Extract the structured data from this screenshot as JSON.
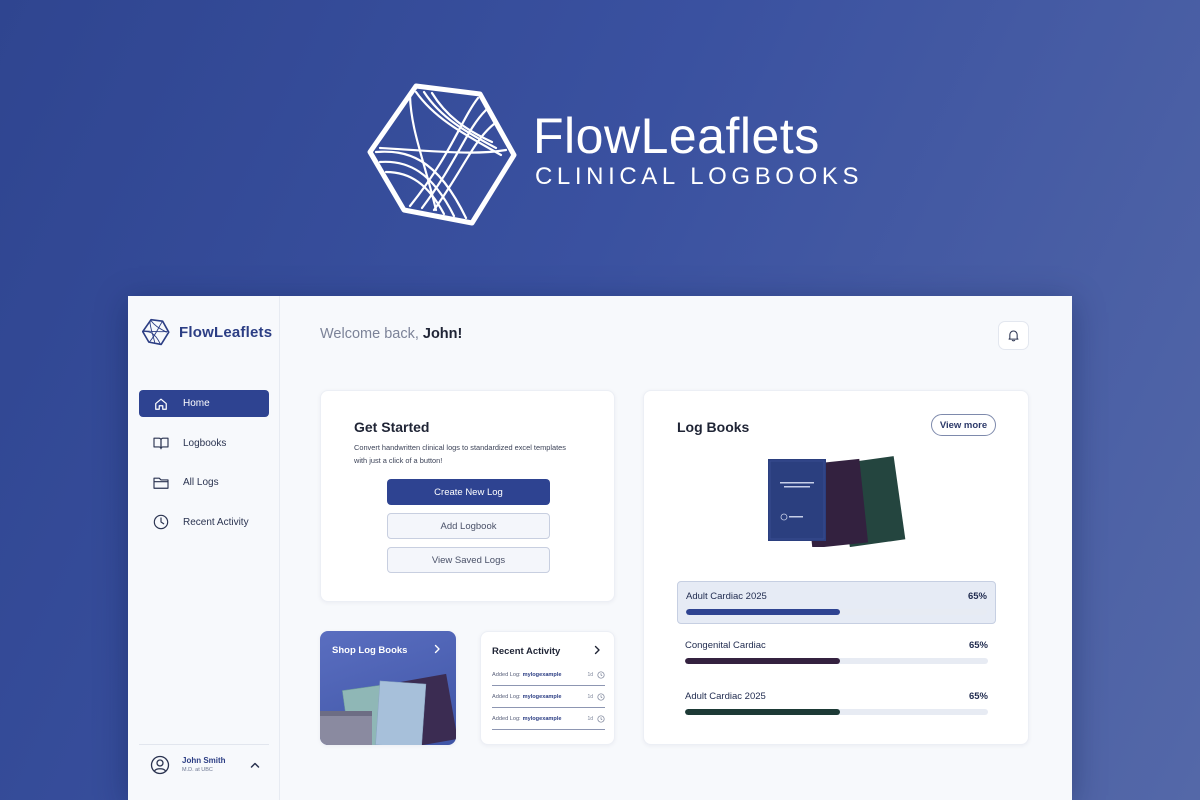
{
  "hero": {
    "title": "FlowLeaflets",
    "subtitle": "CLINICAL LOGBOOKS"
  },
  "sidebar": {
    "brand": "FlowLeaflets",
    "items": [
      {
        "label": "Home",
        "icon": "home-icon",
        "active": true
      },
      {
        "label": "Logbooks",
        "icon": "book-icon",
        "active": false
      },
      {
        "label": "All Logs",
        "icon": "folder-icon",
        "active": false
      },
      {
        "label": "Recent Activity",
        "icon": "clock-icon",
        "active": false
      }
    ],
    "user": {
      "name": "John Smith",
      "role": "M.D. at UBC"
    }
  },
  "header": {
    "welcome_prefix": "Welcome back,",
    "welcome_name": "John!"
  },
  "get_started": {
    "title": "Get Started",
    "description": "Convert handwritten clinical logs to standardized excel templates with just a click of a button!",
    "create_label": "Create New Log",
    "add_label": "Add Logbook",
    "view_label": "View Saved Logs"
  },
  "shop": {
    "title": "Shop Log Books"
  },
  "recent_activity": {
    "title": "Recent Activity",
    "items": [
      {
        "prefix": "Added Log:",
        "name": "mylogexample",
        "time": "1d"
      },
      {
        "prefix": "Added Log:",
        "name": "mylogexample",
        "time": "1d"
      },
      {
        "prefix": "Added Log:",
        "name": "mylogexample",
        "time": "1d"
      }
    ]
  },
  "log_books": {
    "title": "Log Books",
    "view_more_label": "View more",
    "items": [
      {
        "name": "Adult Cardiac 2025",
        "percent_label": "65%",
        "progress": 0.51,
        "color": "#2e4391",
        "active": true
      },
      {
        "name": "Congenital Cardiac",
        "percent_label": "65%",
        "progress": 0.51,
        "color": "#34213f",
        "active": false
      },
      {
        "name": "Adult Cardiac 2025",
        "percent_label": "65%",
        "progress": 0.51,
        "color": "#1d3a36",
        "active": false
      }
    ]
  },
  "colors": {
    "primary": "#2e4391",
    "background_gradient_start": "#2f4590",
    "background_gradient_end": "#5468a8"
  }
}
